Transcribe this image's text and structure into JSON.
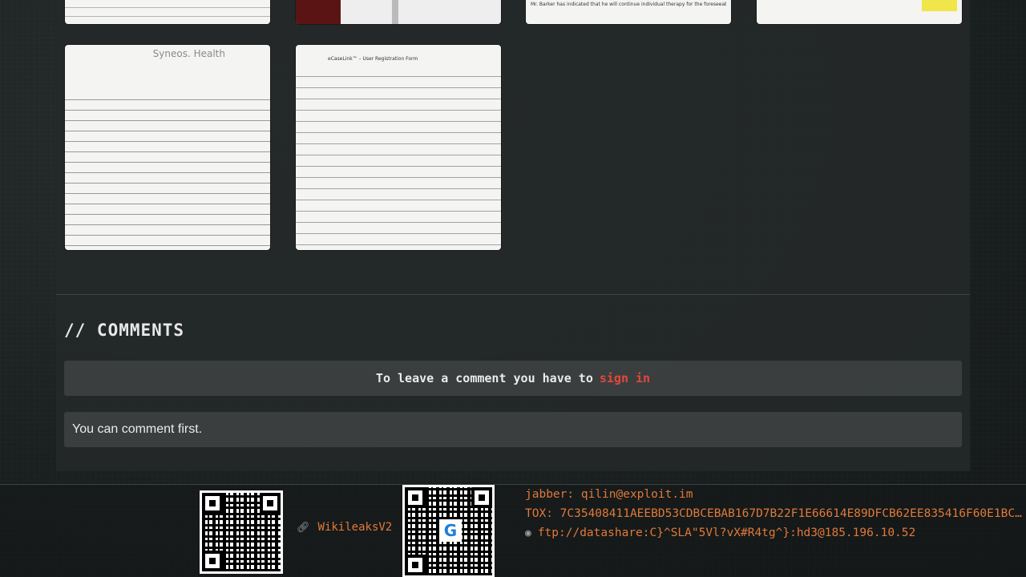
{
  "gallery": {
    "thumbnails": [
      {
        "row": 1,
        "kind": "document",
        "header": ""
      },
      {
        "row": 1,
        "kind": "image",
        "header": ""
      },
      {
        "row": 1,
        "kind": "document",
        "header": "Mr. Barker has indicated that he will continue individual therapy for the foreseeable future."
      },
      {
        "row": 1,
        "kind": "document",
        "header": ""
      },
      {
        "row": 2,
        "kind": "document",
        "header": "Syneos. Health"
      },
      {
        "row": 2,
        "kind": "document",
        "header": "eCaseLink™ – User Registration Form"
      }
    ]
  },
  "comments": {
    "title": "// COMMENTS",
    "signin_prefix": "To leave a comment you have to",
    "signin_link": "sign in",
    "empty_message": "You can comment first."
  },
  "footer": {
    "link_label": "WikileaksV2",
    "jabber": "jabber: qilin@exploit.im",
    "tox": "TOX: 7C35408411AEEBD53CDBCEBAB167D7B22F1E66614E89DFCB62EE835416F60E1BC…",
    "ftp": "ftp://datashare:C}^SLA\"5Vl?vX#R4tg^}:hd3@185.196.10.52"
  },
  "colors": {
    "accent_red": "#e2483d",
    "accent_orange": "#e07a3a"
  }
}
